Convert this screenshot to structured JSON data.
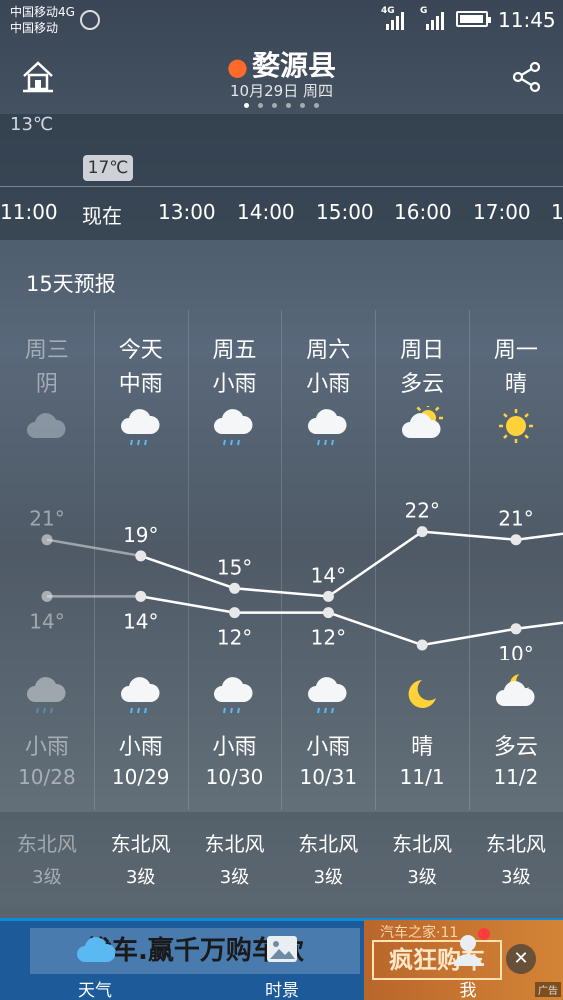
{
  "status_bar": {
    "carrier_line1": "中国移动4G",
    "carrier_line2": "中国移动",
    "network1": "4G",
    "network2": "G",
    "time": "11:45",
    "battery_percent": 90
  },
  "header": {
    "city": "婺源县",
    "date": "10月29日 周四",
    "page_count": 6,
    "page_index": 0
  },
  "hourly": {
    "min_temp": "13℃",
    "current_temp": "17℃",
    "hours": [
      "11:00",
      "现在",
      "13:00",
      "14:00",
      "15:00",
      "16:00",
      "17:00",
      "1"
    ]
  },
  "forecast": {
    "title": "15天预报",
    "days": [
      {
        "day": "周三",
        "day_condition": "阴",
        "day_icon": "cloudy-icon",
        "high": "21°",
        "low": "14°",
        "night_icon": "rain-icon",
        "night_condition": "小雨",
        "date": "10/28",
        "wind_dir": "东北风",
        "wind_level": "3级",
        "past": true
      },
      {
        "day": "今天",
        "day_condition": "中雨",
        "day_icon": "rain-icon",
        "high": "19°",
        "low": "14°",
        "night_icon": "rain-icon",
        "night_condition": "小雨",
        "date": "10/29",
        "wind_dir": "东北风",
        "wind_level": "3级",
        "past": false
      },
      {
        "day": "周五",
        "day_condition": "小雨",
        "day_icon": "rain-icon",
        "high": "15°",
        "low": "12°",
        "night_icon": "rain-icon",
        "night_condition": "小雨",
        "date": "10/30",
        "wind_dir": "东北风",
        "wind_level": "3级",
        "past": false
      },
      {
        "day": "周六",
        "day_condition": "小雨",
        "day_icon": "rain-icon",
        "high": "14°",
        "low": "12°",
        "night_icon": "rain-icon",
        "night_condition": "小雨",
        "date": "10/31",
        "wind_dir": "东北风",
        "wind_level": "3级",
        "past": false
      },
      {
        "day": "周日",
        "day_condition": "多云",
        "day_icon": "partly-cloudy-icon",
        "high": "22°",
        "low": "8°",
        "night_icon": "moon-icon",
        "night_condition": "晴",
        "date": "11/1",
        "wind_dir": "东北风",
        "wind_level": "3级",
        "past": false
      },
      {
        "day": "周一",
        "day_condition": "晴",
        "day_icon": "sun-icon",
        "high": "21°",
        "low": "10°",
        "night_icon": "cloudy-night-icon",
        "night_condition": "多云",
        "date": "11/2",
        "wind_dir": "东北风",
        "wind_level": "3级",
        "past": false
      }
    ],
    "high_values": [
      21,
      19,
      15,
      14,
      22,
      21
    ],
    "low_values": [
      14,
      14,
      12,
      12,
      8,
      10
    ]
  },
  "ad": {
    "banner_text": "找车.赢千万购车款",
    "right_title": "汽车之家·11",
    "right_button": "疯狂购车",
    "tag": "广告"
  },
  "tabs": [
    {
      "label": "天气",
      "icon": "cloud-icon"
    },
    {
      "label": "时景",
      "icon": "photo-icon"
    },
    {
      "label": "我",
      "icon": "person-icon"
    }
  ],
  "colors": {
    "accent": "#0e8ad8",
    "pin": "#ff6a2b",
    "sun": "#ffd23a"
  }
}
